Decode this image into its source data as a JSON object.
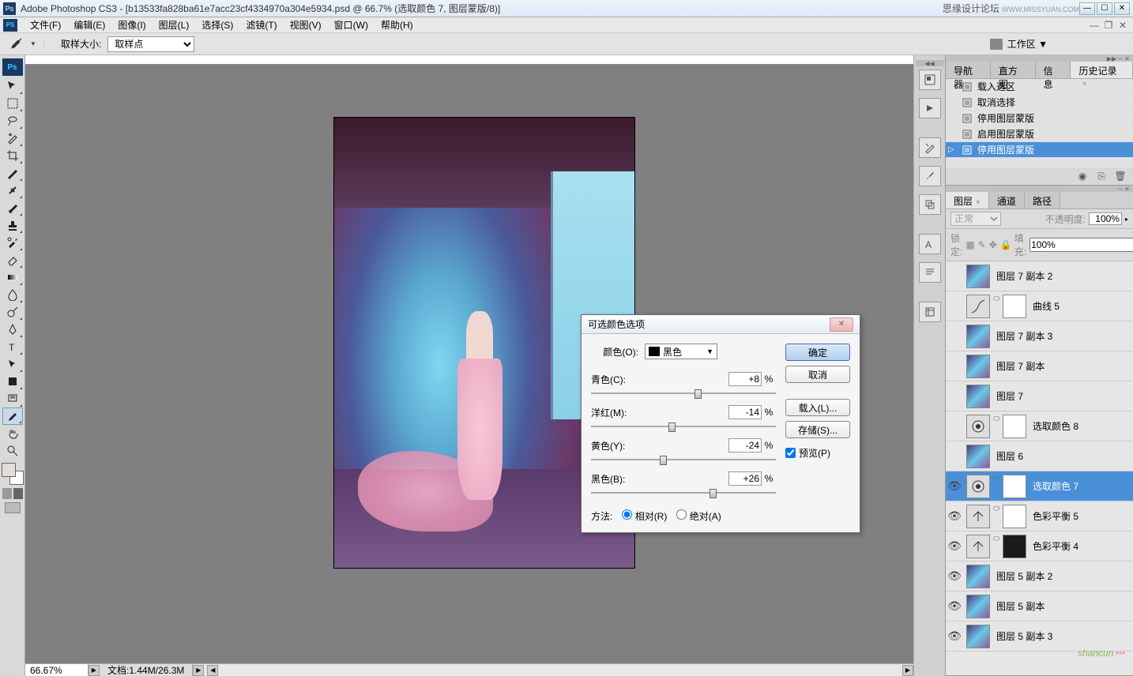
{
  "title": {
    "app": "Adobe Photoshop CS3",
    "doc": "[b13533fa828ba61e7acc23cf4334970a304e5934.psd @ 66.7% (选取颜色 7, 图层蒙版/8)]",
    "forum": "思缘设计论坛",
    "forum_url": "WWW.MISSYUAN.COM"
  },
  "menus": [
    "文件(F)",
    "编辑(E)",
    "图像(I)",
    "图层(L)",
    "选择(S)",
    "滤镜(T)",
    "视图(V)",
    "窗口(W)",
    "帮助(H)"
  ],
  "options": {
    "sample_label": "取样大小:",
    "sample_value": "取样点",
    "workspace": "工作区 ▼"
  },
  "dialog": {
    "title": "可选颜色选项",
    "color_label": "颜色(O):",
    "color_value": "黑色",
    "sliders": [
      {
        "label": "青色(C):",
        "value": "+8",
        "pct": "%",
        "pos": 56
      },
      {
        "label": "洋红(M):",
        "value": "-14",
        "pct": "%",
        "pos": 42
      },
      {
        "label": "黄色(Y):",
        "value": "-24",
        "pct": "%",
        "pos": 37
      },
      {
        "label": "黑色(B):",
        "value": "+26",
        "pct": "%",
        "pos": 64
      }
    ],
    "method_label": "方法:",
    "method_rel": "相对(R)",
    "method_abs": "绝对(A)",
    "ok": "确定",
    "cancel": "取消",
    "load": "载入(L)...",
    "save": "存储(S)...",
    "preview": "预览(P)"
  },
  "history": {
    "tabs": [
      "导航器",
      "直方图",
      "信息",
      "历史记录"
    ],
    "items": [
      {
        "label": "载入选区",
        "sel": false
      },
      {
        "label": "取消选择",
        "sel": false
      },
      {
        "label": "停用图层蒙版",
        "sel": false
      },
      {
        "label": "启用图层蒙版",
        "sel": false
      },
      {
        "label": "停用图层蒙版",
        "sel": true
      }
    ]
  },
  "layers": {
    "tabs": [
      "图层",
      "通道",
      "路径"
    ],
    "blend": "正常",
    "opacity_label": "不透明度:",
    "opacity": "100%",
    "lock_label": "锁定:",
    "fill_label": "填充:",
    "fill": "100%",
    "items": [
      {
        "name": "图层 7 副本 2",
        "vis": false,
        "mask": false,
        "adj": ""
      },
      {
        "name": "曲线 5",
        "vis": false,
        "mask": true,
        "adj": "curve"
      },
      {
        "name": "图层 7 副本 3",
        "vis": false,
        "mask": false,
        "adj": ""
      },
      {
        "name": "图层 7 副本",
        "vis": false,
        "mask": false,
        "adj": ""
      },
      {
        "name": "图层 7",
        "vis": false,
        "mask": false,
        "adj": ""
      },
      {
        "name": "选取颜色 8",
        "vis": false,
        "mask": true,
        "adj": "sel"
      },
      {
        "name": "图层 6",
        "vis": false,
        "mask": false,
        "adj": ""
      },
      {
        "name": "选取颜色 7",
        "vis": true,
        "mask": true,
        "adj": "sel",
        "selected": true
      },
      {
        "name": "色彩平衡 5",
        "vis": true,
        "mask": true,
        "adj": "bal"
      },
      {
        "name": "色彩平衡 4",
        "vis": true,
        "mask": true,
        "adj": "bal",
        "dark": true
      },
      {
        "name": "图层 5 副本 2",
        "vis": true,
        "mask": false,
        "adj": ""
      },
      {
        "name": "图层 5 副本",
        "vis": true,
        "mask": false,
        "adj": ""
      },
      {
        "name": "图层 5 副本 3",
        "vis": true,
        "mask": false,
        "adj": ""
      }
    ]
  },
  "status": {
    "zoom": "66.67%",
    "docinfo": "文档:1.44M/26.3M"
  },
  "watermark": "shancun"
}
